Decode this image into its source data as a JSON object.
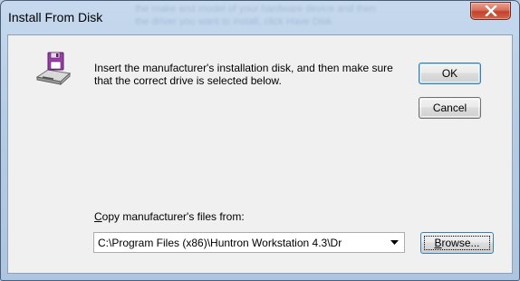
{
  "window": {
    "title": "Install From Disk",
    "background_text_line1": "the make and model of your hardware device and then",
    "background_text_line2": "the driver you want to install, click Have Disk."
  },
  "dialog": {
    "message": "Insert the manufacturer's installation disk, and then make sure that the correct drive is selected below.",
    "ok_label": "OK",
    "cancel_label": "Cancel",
    "copy_label_prefix": "C",
    "copy_label_rest": "opy manufacturer's files from:",
    "path_value": "C:\\Program Files (x86)\\Huntron Workstation 4.3\\Dr",
    "browse_label_prefix": "B",
    "browse_label_rest": "rowse..."
  },
  "icons": {
    "disk": "floppy-disk-drive-icon",
    "close": "close-icon",
    "dropdown": "chevron-down-icon"
  },
  "colors": {
    "close_button": "#c7472f",
    "disk_purple": "#9a3fa8",
    "focus_border": "#3c7fb1"
  }
}
